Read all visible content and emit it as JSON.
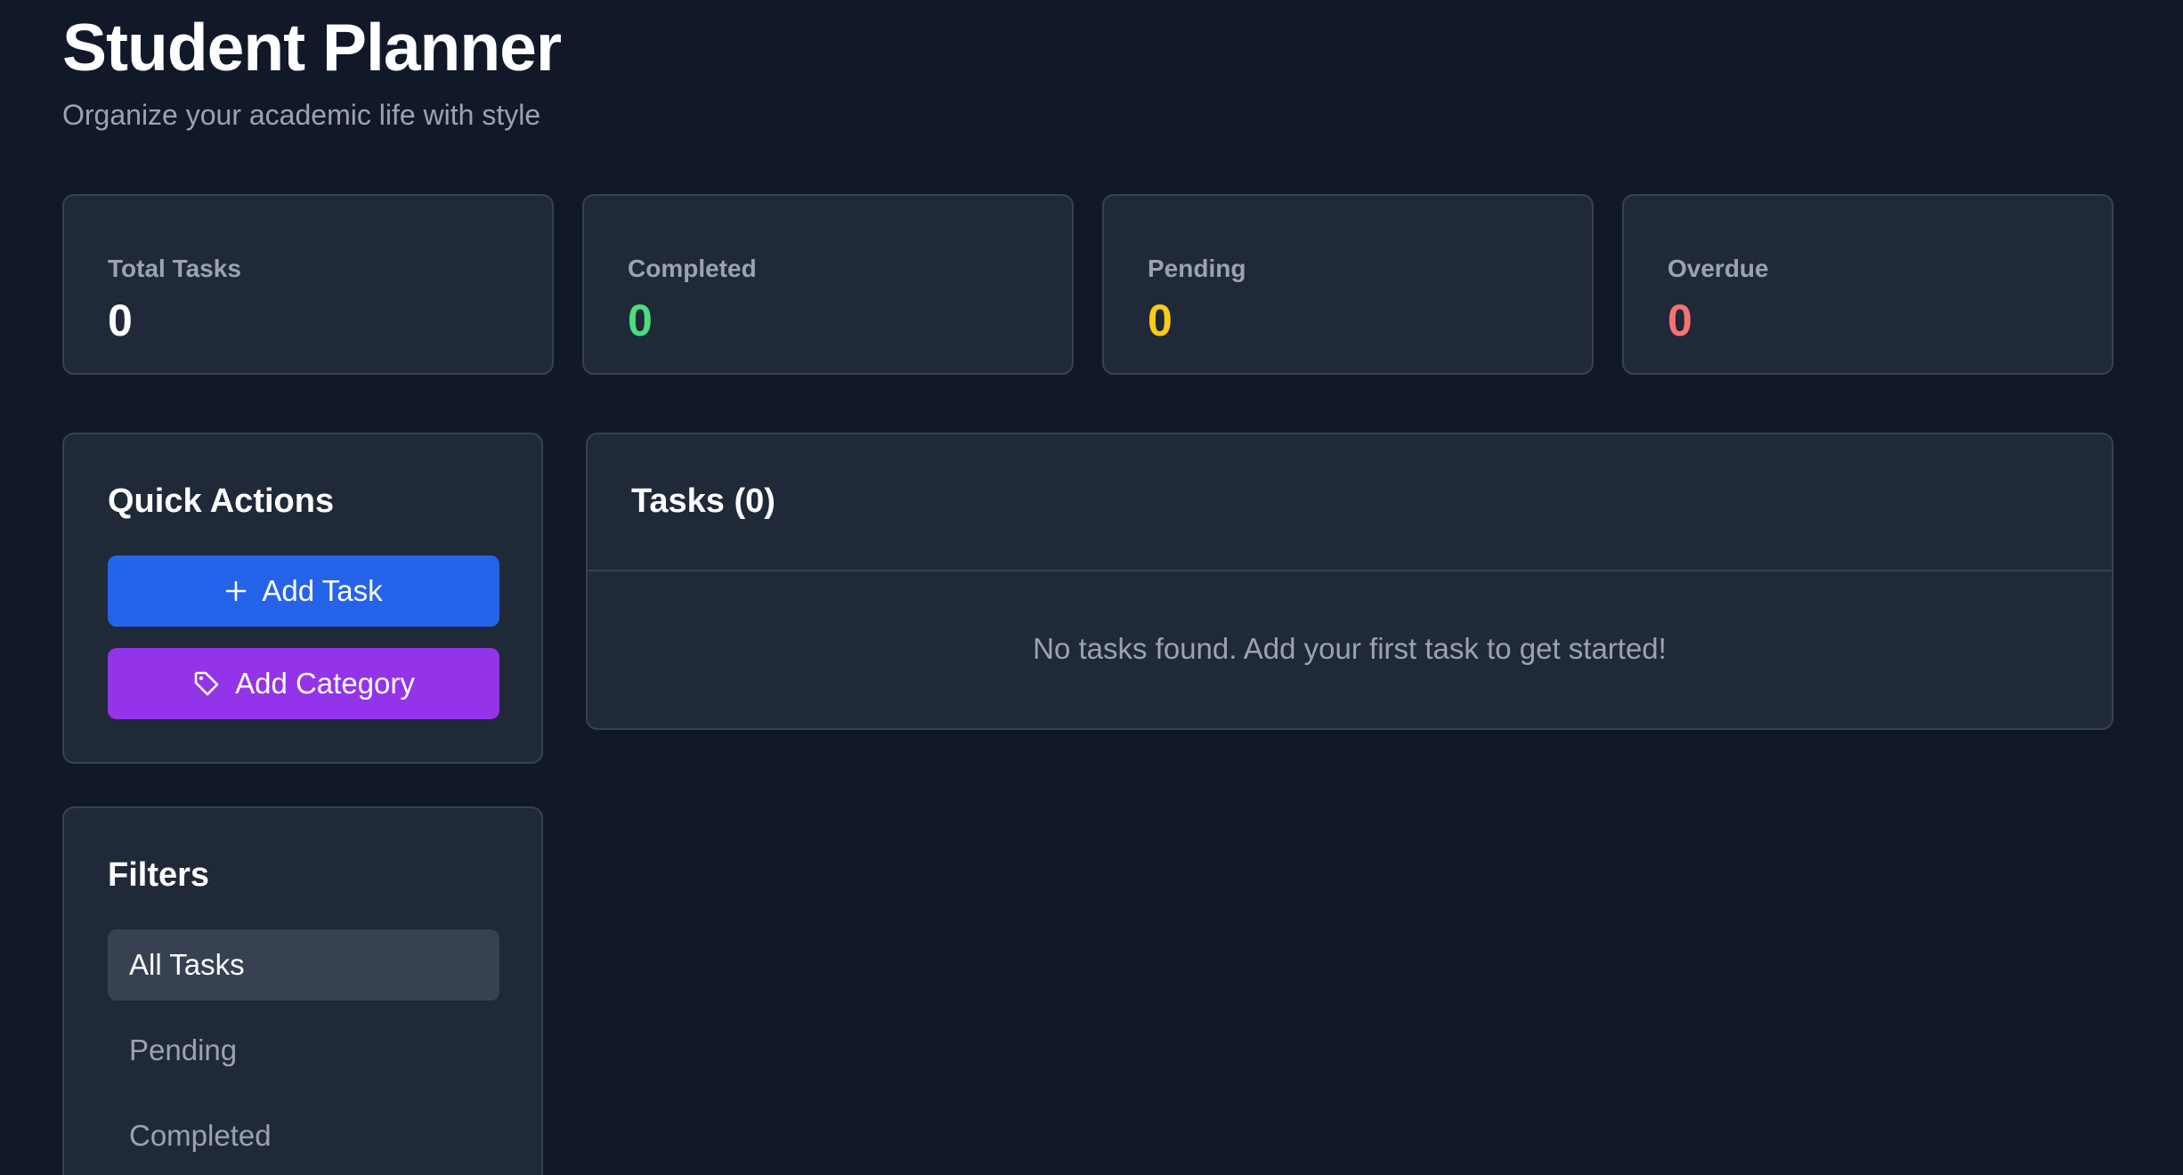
{
  "header": {
    "title": "Student Planner",
    "subtitle": "Organize your academic life with style"
  },
  "stats": [
    {
      "label": "Total Tasks",
      "value": "0",
      "color": "#ffffff"
    },
    {
      "label": "Completed",
      "value": "0",
      "color": "#4ade80"
    },
    {
      "label": "Pending",
      "value": "0",
      "color": "#facc15"
    },
    {
      "label": "Overdue",
      "value": "0",
      "color": "#f87171"
    }
  ],
  "quick_actions": {
    "title": "Quick Actions",
    "add_task_label": "Add Task",
    "add_task_icon": "plus-icon",
    "add_task_color": "#2563eb",
    "add_category_label": "Add Category",
    "add_category_icon": "tag-icon",
    "add_category_color": "#9333ea"
  },
  "filters": {
    "title": "Filters",
    "items": [
      {
        "label": "All Tasks",
        "active": true
      },
      {
        "label": "Pending",
        "active": false
      },
      {
        "label": "Completed",
        "active": false
      }
    ]
  },
  "tasks": {
    "title": "Tasks (0)",
    "empty_message": "No tasks found. Add your first task to get started!"
  }
}
